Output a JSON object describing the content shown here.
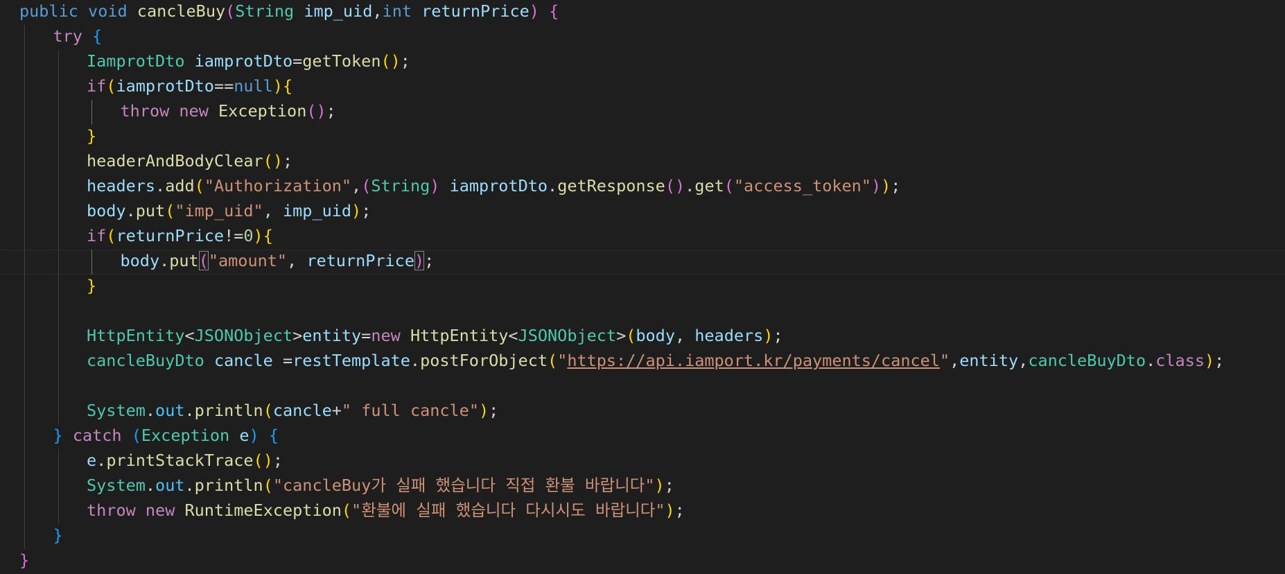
{
  "editor": {
    "language": "java",
    "theme_colors": {
      "background": "#1e1e1e",
      "keyword": "#569cd6",
      "control": "#c586c0",
      "type": "#4ec9b0",
      "function": "#dcdcaa",
      "variable": "#9cdcfe",
      "string": "#ce9178",
      "number": "#b5cea8",
      "bracket_gold": "#ffd700",
      "bracket_orchid": "#da70d6",
      "bracket_blue": "#179fff"
    },
    "current_line": 11,
    "lines": [
      {
        "indent": 0,
        "tokens": [
          [
            "kw",
            "public"
          ],
          [
            "op",
            " "
          ],
          [
            "kw",
            "void"
          ],
          [
            "op",
            " "
          ],
          [
            "fn",
            "cancleBuy"
          ],
          [
            "b2",
            "("
          ],
          [
            "ty",
            "String"
          ],
          [
            "op",
            " "
          ],
          [
            "va",
            "imp_uid"
          ],
          [
            "op",
            ","
          ],
          [
            "kw",
            "int"
          ],
          [
            "op",
            " "
          ],
          [
            "va",
            "returnPrice"
          ],
          [
            "b2",
            ")"
          ],
          [
            "op",
            " "
          ],
          [
            "b2",
            "{"
          ]
        ]
      },
      {
        "indent": 1,
        "tokens": [
          [
            "ctl",
            "try"
          ],
          [
            "op",
            " "
          ],
          [
            "b3",
            "{"
          ]
        ]
      },
      {
        "indent": 2,
        "tokens": [
          [
            "ty",
            "IamprotDto"
          ],
          [
            "op",
            " "
          ],
          [
            "va",
            "iamprotDto"
          ],
          [
            "op",
            "="
          ],
          [
            "fn",
            "getToken"
          ],
          [
            "b1",
            "()"
          ],
          [
            "op",
            ";"
          ]
        ]
      },
      {
        "indent": 2,
        "tokens": [
          [
            "ctl",
            "if"
          ],
          [
            "b1",
            "("
          ],
          [
            "va",
            "iamprotDto"
          ],
          [
            "op",
            "=="
          ],
          [
            "kw",
            "null"
          ],
          [
            "b1",
            ")"
          ],
          [
            "b1",
            "{"
          ]
        ]
      },
      {
        "indent": 3,
        "tokens": [
          [
            "ctl",
            "throw"
          ],
          [
            "op",
            " "
          ],
          [
            "ctl",
            "new"
          ],
          [
            "op",
            " "
          ],
          [
            "fn",
            "Exception"
          ],
          [
            "b2",
            "()"
          ],
          [
            "op",
            ";"
          ]
        ]
      },
      {
        "indent": 2,
        "tokens": [
          [
            "b1",
            "}"
          ]
        ]
      },
      {
        "indent": 2,
        "tokens": [
          [
            "fn",
            "headerAndBodyClear"
          ],
          [
            "b1",
            "()"
          ],
          [
            "op",
            ";"
          ]
        ]
      },
      {
        "indent": 2,
        "tokens": [
          [
            "va",
            "headers"
          ],
          [
            "op",
            "."
          ],
          [
            "fn",
            "add"
          ],
          [
            "b1",
            "("
          ],
          [
            "str",
            "\"Authorization\""
          ],
          [
            "op",
            ","
          ],
          [
            "b2",
            "("
          ],
          [
            "ty",
            "String"
          ],
          [
            "b2",
            ")"
          ],
          [
            "op",
            " "
          ],
          [
            "va",
            "iamprotDto"
          ],
          [
            "op",
            "."
          ],
          [
            "fn",
            "getResponse"
          ],
          [
            "b2",
            "()"
          ],
          [
            "op",
            "."
          ],
          [
            "fn",
            "get"
          ],
          [
            "b2",
            "("
          ],
          [
            "str",
            "\"access_token\""
          ],
          [
            "b2",
            ")"
          ],
          [
            "b1",
            ")"
          ],
          [
            "op",
            ";"
          ]
        ]
      },
      {
        "indent": 2,
        "tokens": [
          [
            "va",
            "body"
          ],
          [
            "op",
            "."
          ],
          [
            "fn",
            "put"
          ],
          [
            "b1",
            "("
          ],
          [
            "str",
            "\"imp_uid\""
          ],
          [
            "op",
            ", "
          ],
          [
            "va",
            "imp_uid"
          ],
          [
            "b1",
            ")"
          ],
          [
            "op",
            ";"
          ]
        ]
      },
      {
        "indent": 2,
        "tokens": [
          [
            "ctl",
            "if"
          ],
          [
            "b1",
            "("
          ],
          [
            "va",
            "returnPrice"
          ],
          [
            "op",
            "!="
          ],
          [
            "num",
            "0"
          ],
          [
            "b1",
            ")"
          ],
          [
            "b1",
            "{"
          ]
        ]
      },
      {
        "indent": 3,
        "tokens": [
          [
            "va",
            "body"
          ],
          [
            "op",
            "."
          ],
          [
            "fn",
            "put"
          ],
          [
            "b2 match",
            "("
          ],
          [
            "str",
            "\"amount\""
          ],
          [
            "op",
            ", "
          ],
          [
            "va",
            "returnPrice"
          ],
          [
            "b2 match",
            ")"
          ],
          [
            "op",
            ";"
          ]
        ]
      },
      {
        "indent": 2,
        "tokens": [
          [
            "b1",
            "}"
          ]
        ]
      },
      {
        "indent": 0,
        "tokens": []
      },
      {
        "indent": 2,
        "tokens": [
          [
            "ty",
            "HttpEntity"
          ],
          [
            "op",
            "<"
          ],
          [
            "ty",
            "JSONObject"
          ],
          [
            "op",
            ">"
          ],
          [
            "va",
            "entity"
          ],
          [
            "op",
            "="
          ],
          [
            "ctl",
            "new"
          ],
          [
            "op",
            " "
          ],
          [
            "fn",
            "HttpEntity"
          ],
          [
            "op",
            "<"
          ],
          [
            "ty",
            "JSONObject"
          ],
          [
            "op",
            ">"
          ],
          [
            "b1",
            "("
          ],
          [
            "va",
            "body"
          ],
          [
            "op",
            ", "
          ],
          [
            "va",
            "headers"
          ],
          [
            "b1",
            ")"
          ],
          [
            "op",
            ";"
          ]
        ]
      },
      {
        "indent": 2,
        "tokens": [
          [
            "ty",
            "cancleBuyDto"
          ],
          [
            "op",
            " "
          ],
          [
            "va",
            "cancle"
          ],
          [
            "op",
            " ="
          ],
          [
            "va",
            "restTemplate"
          ],
          [
            "op",
            "."
          ],
          [
            "fn",
            "postForObject"
          ],
          [
            "b1",
            "("
          ],
          [
            "str",
            "\""
          ],
          [
            "url",
            "https://api.iamport.kr/payments/cancel"
          ],
          [
            "str",
            "\""
          ],
          [
            "op",
            ","
          ],
          [
            "va",
            "entity"
          ],
          [
            "op",
            ","
          ],
          [
            "ty",
            "cancleBuyDto"
          ],
          [
            "op",
            "."
          ],
          [
            "ctl",
            "class"
          ],
          [
            "b1",
            ")"
          ],
          [
            "op",
            ";"
          ]
        ]
      },
      {
        "indent": 0,
        "tokens": []
      },
      {
        "indent": 2,
        "tokens": [
          [
            "ty",
            "System"
          ],
          [
            "op",
            "."
          ],
          [
            "fld",
            "out"
          ],
          [
            "op",
            "."
          ],
          [
            "fn",
            "println"
          ],
          [
            "b1",
            "("
          ],
          [
            "va",
            "cancle"
          ],
          [
            "op",
            "+"
          ],
          [
            "str",
            "\" full cancle\""
          ],
          [
            "b1",
            ")"
          ],
          [
            "op",
            ";"
          ]
        ]
      },
      {
        "indent": 1,
        "tokens": [
          [
            "b3",
            "}"
          ],
          [
            "op",
            " "
          ],
          [
            "ctl",
            "catch"
          ],
          [
            "op",
            " "
          ],
          [
            "b3",
            "("
          ],
          [
            "ty",
            "Exception"
          ],
          [
            "op",
            " "
          ],
          [
            "va",
            "e"
          ],
          [
            "b3",
            ")"
          ],
          [
            "op",
            " "
          ],
          [
            "b3",
            "{"
          ]
        ]
      },
      {
        "indent": 2,
        "tokens": [
          [
            "va",
            "e"
          ],
          [
            "op",
            "."
          ],
          [
            "fn",
            "printStackTrace"
          ],
          [
            "b1",
            "()"
          ],
          [
            "op",
            ";"
          ]
        ]
      },
      {
        "indent": 2,
        "tokens": [
          [
            "ty",
            "System"
          ],
          [
            "op",
            "."
          ],
          [
            "fld",
            "out"
          ],
          [
            "op",
            "."
          ],
          [
            "fn",
            "println"
          ],
          [
            "b1",
            "("
          ],
          [
            "str",
            "\"cancleBuy가 실패 했습니다 직접 환불 바랍니다\""
          ],
          [
            "b1",
            ")"
          ],
          [
            "op",
            ";"
          ]
        ]
      },
      {
        "indent": 2,
        "tokens": [
          [
            "ctl",
            "throw"
          ],
          [
            "op",
            " "
          ],
          [
            "ctl",
            "new"
          ],
          [
            "op",
            " "
          ],
          [
            "fn",
            "RuntimeException"
          ],
          [
            "b1",
            "("
          ],
          [
            "str",
            "\"환불에 실패 했습니다 다시시도 바랍니다\""
          ],
          [
            "b1",
            ")"
          ],
          [
            "op",
            ";"
          ]
        ]
      },
      {
        "indent": 1,
        "tokens": [
          [
            "b3",
            "}"
          ]
        ]
      },
      {
        "indent": 0,
        "tokens": [
          [
            "b2",
            "}"
          ]
        ]
      }
    ]
  }
}
